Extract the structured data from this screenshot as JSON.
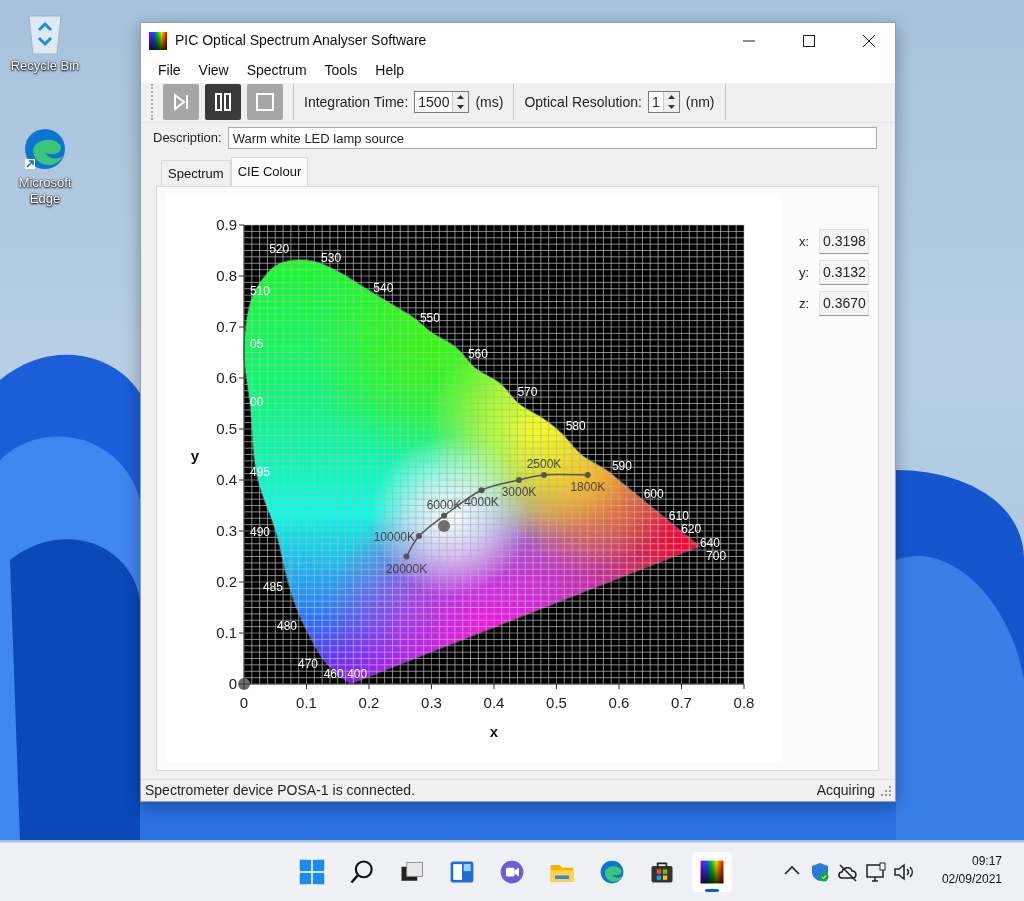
{
  "desktop_icons": [
    {
      "kind": "recycle-bin",
      "label": "Recycle Bin"
    },
    {
      "kind": "edge",
      "label": "Microsoft Edge"
    }
  ],
  "window": {
    "title": "PIC Optical Spectrum Analyser Software"
  },
  "menu": [
    "File",
    "View",
    "Spectrum",
    "Tools",
    "Help"
  ],
  "toolbar": {
    "buttons": [
      {
        "kind": "step",
        "disabled": true
      },
      {
        "kind": "pause",
        "disabled": false
      },
      {
        "kind": "stop",
        "disabled": true
      }
    ],
    "spinners": [
      {
        "label": "Integration Time:",
        "value": "1500",
        "unit": "(ms)"
      },
      {
        "label": "Optical Resolution:",
        "value": "1",
        "unit": "(nm)"
      }
    ]
  },
  "description": {
    "label": "Description:",
    "value": "Warm white LED lamp source"
  },
  "tabs": [
    {
      "label": "Spectrum",
      "selected": false
    },
    {
      "label": "CIE Colour",
      "selected": true
    }
  ],
  "chart": {
    "chart_data": {
      "type": "line",
      "xlabel": "x",
      "ylabel": "y",
      "xlim": [
        0,
        0.8
      ],
      "ylim": [
        0,
        0.9
      ],
      "grid": true,
      "xticks": [
        0,
        0.1,
        0.2,
        0.3,
        0.4,
        0.5,
        0.6,
        0.7,
        0.8
      ],
      "yticks": [
        0,
        0.1,
        0.2,
        0.3,
        0.4,
        0.5,
        0.6,
        0.7,
        0.8,
        0.9
      ],
      "series": [
        {
          "type": "area",
          "x": [
            0.17,
            0.14,
            0.12,
            0.09,
            0.07,
            0.05,
            0.02,
            0.01,
            0.0,
            0.01,
            0.04,
            0.07,
            0.11,
            0.15,
            0.19,
            0.23,
            0.27,
            0.3,
            0.34,
            0.37,
            0.41,
            0.44,
            0.48,
            0.51,
            0.54,
            0.58,
            0.6,
            0.63,
            0.67,
            0.69,
            0.72,
            0.73
          ],
          "values": [
            0.0,
            0.03,
            0.06,
            0.13,
            0.2,
            0.3,
            0.41,
            0.54,
            0.65,
            0.75,
            0.81,
            0.83,
            0.83,
            0.81,
            0.78,
            0.75,
            0.72,
            0.69,
            0.66,
            0.62,
            0.59,
            0.55,
            0.52,
            0.49,
            0.45,
            0.42,
            0.4,
            0.37,
            0.33,
            0.31,
            0.28,
            0.27
          ]
        },
        {
          "color": "#555555",
          "marker": true,
          "x": [
            0.26,
            0.28,
            0.32,
            0.38,
            0.44,
            0.48,
            0.55
          ],
          "values": [
            0.25,
            0.29,
            0.33,
            0.38,
            0.4,
            0.41,
            0.41
          ]
        },
        {
          "color": "#6e6e6e",
          "marker": true,
          "x": [
            0.32
          ],
          "values": [
            0.31
          ]
        },
        {
          "color": "#6e6e6e",
          "marker": true,
          "x": [
            0
          ],
          "values": [
            0
          ]
        }
      ],
      "annotations": [
        {
          "text": "520",
          "x": 0.07,
          "y": 0.83
        },
        {
          "text": "530",
          "x": 0.15,
          "y": 0.81
        },
        {
          "text": "540",
          "x": 0.23,
          "y": 0.75
        },
        {
          "text": "550",
          "x": 0.3,
          "y": 0.69
        },
        {
          "text": "560",
          "x": 0.37,
          "y": 0.62
        },
        {
          "text": "570",
          "x": 0.44,
          "y": 0.55
        },
        {
          "text": "580",
          "x": 0.51,
          "y": 0.49
        },
        {
          "text": "590",
          "x": 0.58,
          "y": 0.42
        },
        {
          "text": "600",
          "x": 0.63,
          "y": 0.37
        },
        {
          "text": "610",
          "x": 0.67,
          "y": 0.33
        },
        {
          "text": "620",
          "x": 0.69,
          "y": 0.31
        },
        {
          "text": "640",
          "x": 0.72,
          "y": 0.28
        },
        {
          "text": "700",
          "x": 0.73,
          "y": 0.27
        },
        {
          "text": "510",
          "x": 0.01,
          "y": 0.75
        },
        {
          "text": "05",
          "x": 0.0,
          "y": 0.65
        },
        {
          "text": "00",
          "x": 0.01,
          "y": 0.54
        },
        {
          "text": "495",
          "x": 0.02,
          "y": 0.41
        },
        {
          "text": "490",
          "x": 0.05,
          "y": 0.3
        },
        {
          "text": "485",
          "x": 0.07,
          "y": 0.2
        },
        {
          "text": "480",
          "x": 0.09,
          "y": 0.13
        },
        {
          "text": "470",
          "x": 0.12,
          "y": 0.06
        },
        {
          "text": "460",
          "x": 0.14,
          "y": 0.03
        },
        {
          "text": "400",
          "x": 0.17,
          "y": 0.0
        },
        {
          "text": "20000K",
          "x": 0.26,
          "y": 0.25
        },
        {
          "text": "10000K",
          "x": 0.28,
          "y": 0.29
        },
        {
          "text": "6000K",
          "x": 0.32,
          "y": 0.33
        },
        {
          "text": "4000K",
          "x": 0.38,
          "y": 0.38
        },
        {
          "text": "3000K",
          "x": 0.44,
          "y": 0.4
        },
        {
          "text": "2500K",
          "x": 0.48,
          "y": 0.41
        },
        {
          "text": "1800K",
          "x": 0.55,
          "y": 0.41
        }
      ]
    }
  },
  "coordinates": [
    {
      "label": "x:",
      "value": "0.3198"
    },
    {
      "label": "y:",
      "value": "0.3132"
    },
    {
      "label": "z:",
      "value": "0.3670"
    }
  ],
  "status_bar": {
    "message": "Spectrometer device POSA-1 is connected.",
    "state": "Acquiring"
  },
  "taskbar": {
    "items": [
      {
        "kind": "start",
        "active": false
      },
      {
        "kind": "search",
        "active": false
      },
      {
        "kind": "task-view",
        "active": false
      },
      {
        "kind": "widgets",
        "active": false
      },
      {
        "kind": "chat",
        "active": false
      },
      {
        "kind": "folder",
        "active": false
      },
      {
        "kind": "edge",
        "active": false
      },
      {
        "kind": "store",
        "active": false
      },
      {
        "kind": "spectrum-app",
        "active": true
      }
    ],
    "tray": [
      {
        "kind": "chevron"
      },
      {
        "kind": "shield"
      },
      {
        "kind": "cloud-off"
      },
      {
        "kind": "network"
      },
      {
        "kind": "volume"
      }
    ],
    "time": "09:17",
    "date": "02/09/2021"
  }
}
